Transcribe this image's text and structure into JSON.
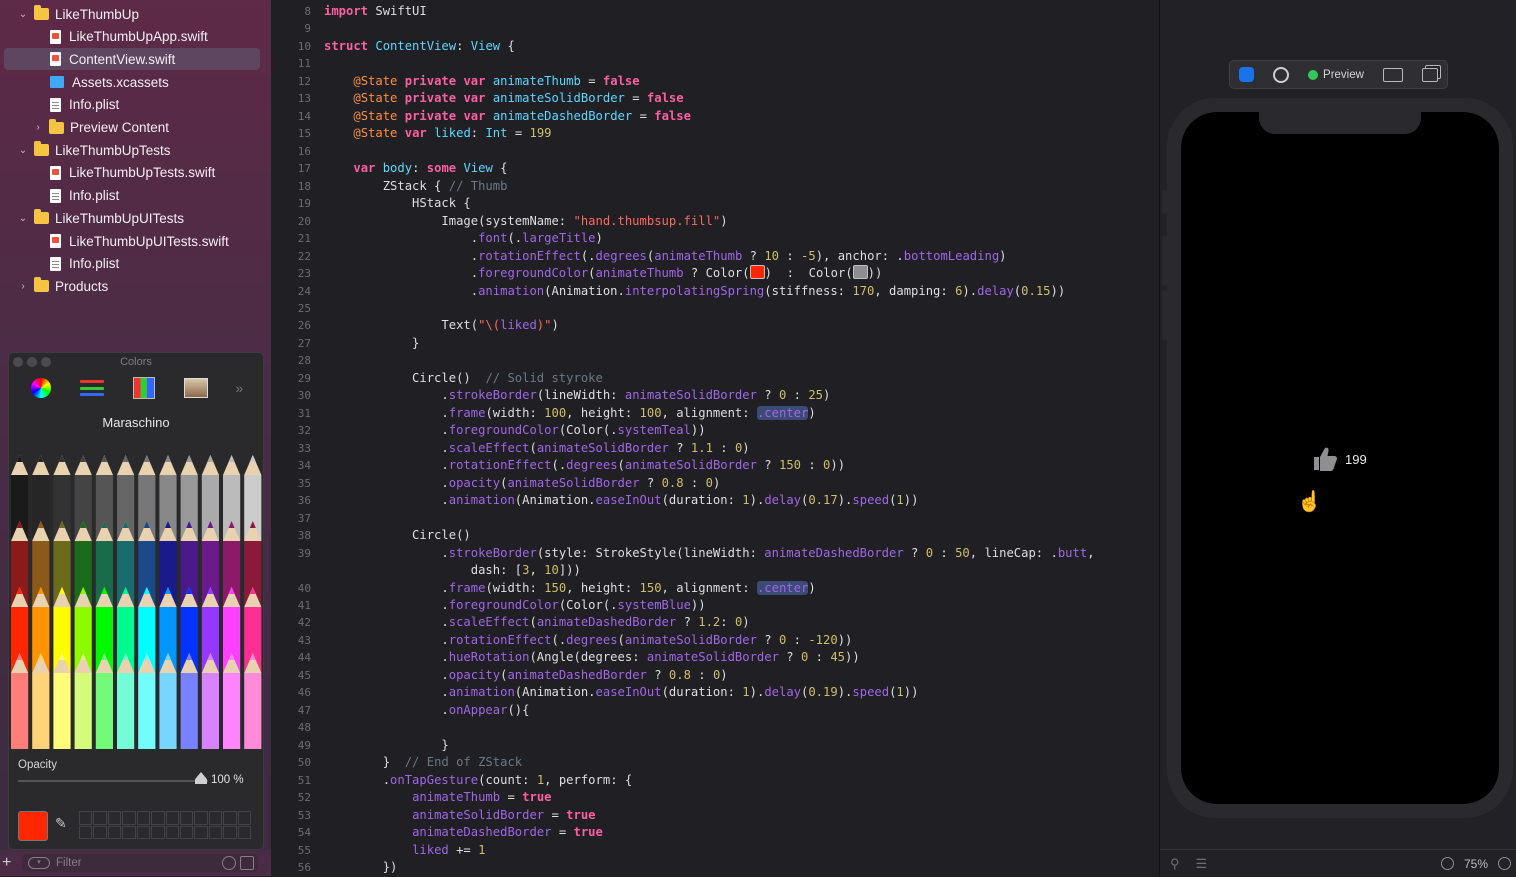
{
  "navigator": {
    "items": [
      {
        "label": "LikeThumbUp",
        "kind": "folder",
        "expanded": true,
        "depth": 0
      },
      {
        "label": "LikeThumbUpApp.swift",
        "kind": "swift",
        "depth": 1
      },
      {
        "label": "ContentView.swift",
        "kind": "swift",
        "depth": 1,
        "selected": true
      },
      {
        "label": "Assets.xcassets",
        "kind": "assets",
        "depth": 1
      },
      {
        "label": "Info.plist",
        "kind": "plist",
        "depth": 1
      },
      {
        "label": "Preview Content",
        "kind": "folder",
        "expanded": false,
        "depth": 1
      },
      {
        "label": "LikeThumbUpTests",
        "kind": "folder",
        "expanded": true,
        "depth": 0
      },
      {
        "label": "LikeThumbUpTests.swift",
        "kind": "swift",
        "depth": 1
      },
      {
        "label": "Info.plist",
        "kind": "plist",
        "depth": 1
      },
      {
        "label": "LikeThumbUpUITests",
        "kind": "folder",
        "expanded": true,
        "depth": 0
      },
      {
        "label": "LikeThumbUpUITests.swift",
        "kind": "swift",
        "depth": 1
      },
      {
        "label": "Info.plist",
        "kind": "plist",
        "depth": 1
      },
      {
        "label": "Products",
        "kind": "folder",
        "expanded": false,
        "depth": 0
      }
    ],
    "filter_placeholder": "Filter"
  },
  "colors_panel": {
    "title": "Colors",
    "color_name": "Maraschino",
    "opacity_label": "Opacity",
    "opacity_value": "100 %",
    "opacity_fraction": 1.0,
    "selected_color": "#ff2600"
  },
  "editor": {
    "lines": [
      {
        "n": "8",
        "html": "<span class='kw'>import</span> SwiftUI"
      },
      {
        "n": "9",
        "html": ""
      },
      {
        "n": "10",
        "html": "<span class='kw'>struct</span> <span class='ty'>ContentView</span>: <span class='ty'>View</span> {"
      },
      {
        "n": "11",
        "html": ""
      },
      {
        "n": "12",
        "html": "    <span class='at'>@State</span> <span class='kw'>private</span> <span class='kw'>var</span> <span class='ty'>animateThumb</span> = <span class='kw'>false</span>"
      },
      {
        "n": "13",
        "html": "    <span class='at'>@State</span> <span class='kw'>private</span> <span class='kw'>var</span> <span class='ty'>animateSolidBorder</span> = <span class='kw'>false</span>"
      },
      {
        "n": "14",
        "html": "    <span class='at'>@State</span> <span class='kw'>private</span> <span class='kw'>var</span> <span class='ty'>animateDashedBorder</span> = <span class='kw'>false</span>"
      },
      {
        "n": "15",
        "html": "    <span class='at'>@State</span> <span class='kw'>var</span> <span class='ty'>liked</span>: <span class='ty'>Int</span> = <span class='nm'>199</span>"
      },
      {
        "n": "16",
        "html": ""
      },
      {
        "n": "17",
        "html": "    <span class='kw'>var</span> <span class='ty'>body</span>: <span class='kw'>some</span> <span class='ty'>View</span> {"
      },
      {
        "n": "18",
        "html": "        ZStack { <span class='cm'>// Thumb</span>"
      },
      {
        "n": "19",
        "html": "            HStack {"
      },
      {
        "n": "20",
        "html": "                Image(systemName: <span class='st'>\"hand.thumbsup.fill\"</span>)"
      },
      {
        "n": "21",
        "html": "                    .<span class='fn'>font</span>(.<span class='pr'>largeTitle</span>)"
      },
      {
        "n": "22",
        "html": "                    .<span class='fn'>rotationEffect</span>(.<span class='fn'>degrees</span>(<span class='pr'>animateThumb</span> ? <span class='nm'>10</span> : <span class='nm'>-5</span>), anchor: .<span class='pr'>bottomLeading</span>)"
      },
      {
        "n": "23",
        "html": "                    .<span class='fn'>foregroundColor</span>(<span class='pr'>animateThumb</span> ? Color(<span class='cbox' style='background:#ff2600'></span>)  :  Color(<span class='cbox' style='background:#8e8e93'></span>))"
      },
      {
        "n": "24",
        "html": "                    .<span class='fn'>animation</span>(Animation.<span class='fn'>interpolatingSpring</span>(stiffness: <span class='nm'>170</span>, damping: <span class='nm'>6</span>).<span class='fn'>delay</span>(<span class='nm'>0.15</span>))"
      },
      {
        "n": "25",
        "html": ""
      },
      {
        "n": "26",
        "html": "                Text(<span class='st'>\"\\(</span><span class='pr'>liked</span><span class='st'>)\"</span>)"
      },
      {
        "n": "27",
        "html": "            }"
      },
      {
        "n": "28",
        "html": ""
      },
      {
        "n": "29",
        "html": "            Circle()  <span class='cm'>// Solid styroke</span>"
      },
      {
        "n": "30",
        "html": "                .<span class='fn'>strokeBorder</span>(lineWidth: <span class='pr'>animateSolidBorder</span> ? <span class='nm'>0</span> : <span class='nm'>25</span>)"
      },
      {
        "n": "31",
        "html": "                .<span class='fn'>frame</span>(width: <span class='nm'>100</span>, height: <span class='nm'>100</span>, alignment: <span class='hl'>.center</span>)"
      },
      {
        "n": "32",
        "html": "                .<span class='fn'>foregroundColor</span>(Color(.<span class='pr'>systemTeal</span>))"
      },
      {
        "n": "33",
        "html": "                .<span class='fn'>scaleEffect</span>(<span class='pr'>animateSolidBorder</span> ? <span class='nm'>1.1</span> : <span class='nm'>0</span>)"
      },
      {
        "n": "34",
        "html": "                .<span class='fn'>rotationEffect</span>(.<span class='fn'>degrees</span>(<span class='pr'>animateSolidBorder</span> ? <span class='nm'>150</span> : <span class='nm'>0</span>))"
      },
      {
        "n": "35",
        "html": "                .<span class='fn'>opacity</span>(<span class='pr'>animateSolidBorder</span> ? <span class='nm'>0.8</span> : <span class='nm'>0</span>)"
      },
      {
        "n": "36",
        "html": "                .<span class='fn'>animation</span>(Animation.<span class='fn'>easeInOut</span>(duration: <span class='nm'>1</span>).<span class='fn'>delay</span>(<span class='nm'>0.17</span>).<span class='fn'>speed</span>(<span class='nm'>1</span>))"
      },
      {
        "n": "37",
        "html": ""
      },
      {
        "n": "38",
        "html": "            Circle()"
      },
      {
        "n": "39",
        "html": "                .<span class='fn'>strokeBorder</span>(style: StrokeStyle(lineWidth: <span class='pr'>animateDashedBorder</span> ? <span class='nm'>0</span> : <span class='nm'>50</span>, lineCap: .<span class='pr'>butt</span>,"
      },
      {
        "n": "",
        "html": "                    dash: [<span class='nm'>3</span>, <span class='nm'>10</span>]))"
      },
      {
        "n": "40",
        "html": "                .<span class='fn'>frame</span>(width: <span class='nm'>150</span>, height: <span class='nm'>150</span>, alignment: <span class='hl'>.center</span>)"
      },
      {
        "n": "41",
        "html": "                .<span class='fn'>foregroundColor</span>(Color(.<span class='pr'>systemBlue</span>))"
      },
      {
        "n": "42",
        "html": "                .<span class='fn'>scaleEffect</span>(<span class='pr'>animateDashedBorder</span> ? <span class='nm'>1.2</span>: <span class='nm'>0</span>)"
      },
      {
        "n": "43",
        "html": "                .<span class='fn'>rotationEffect</span>(.<span class='fn'>degrees</span>(<span class='pr'>animateSolidBorder</span> ? <span class='nm'>0</span> : <span class='nm'>-120</span>))"
      },
      {
        "n": "44",
        "html": "                .<span class='fn'>hueRotation</span>(Angle(degrees: <span class='pr'>animateSolidBorder</span> ? <span class='nm'>0</span> : <span class='nm'>45</span>))"
      },
      {
        "n": "45",
        "html": "                .<span class='fn'>opacity</span>(<span class='pr'>animateDashedBorder</span> ? <span class='nm'>0.8</span> : <span class='nm'>0</span>)"
      },
      {
        "n": "46",
        "html": "                .<span class='fn'>animation</span>(Animation.<span class='fn'>easeInOut</span>(duration: <span class='nm'>1</span>).<span class='fn'>delay</span>(<span class='nm'>0.19</span>).<span class='fn'>speed</span>(<span class='nm'>1</span>))"
      },
      {
        "n": "47",
        "html": "                .<span class='fn'>onAppear</span>(){"
      },
      {
        "n": "48",
        "html": ""
      },
      {
        "n": "49",
        "html": "                }"
      },
      {
        "n": "50",
        "html": "        }  <span class='cm'>// End of ZStack</span>"
      },
      {
        "n": "51",
        "html": "        .<span class='fn'>onTapGesture</span>(count: <span class='nm'>1</span>, perform: {"
      },
      {
        "n": "52",
        "html": "            <span class='pr'>animateThumb</span> = <span class='kw'>true</span>"
      },
      {
        "n": "53",
        "html": "            <span class='pr'>animateSolidBorder</span> = <span class='kw'>true</span>"
      },
      {
        "n": "54",
        "html": "            <span class='pr'>animateDashedBorder</span> = <span class='kw'>true</span>"
      },
      {
        "n": "55",
        "html": "            <span class='pr'>liked</span> += <span class='nm'>1</span>"
      },
      {
        "n": "56",
        "html": "        })"
      }
    ]
  },
  "canvas": {
    "toolbar": {
      "preview_label": "Preview"
    },
    "preview": {
      "like_count": "199"
    },
    "zoom": "75%"
  }
}
